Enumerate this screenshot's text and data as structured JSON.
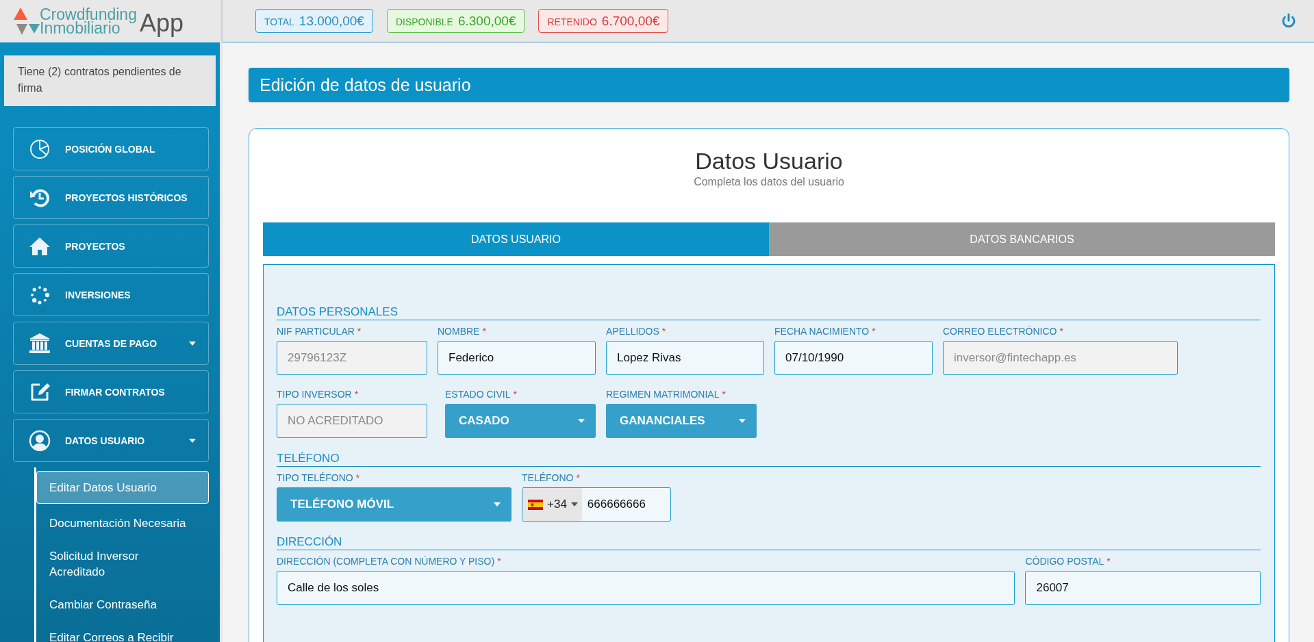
{
  "logo": {
    "line_1": "Crowdfunding",
    "line_2": "Inmobiliario",
    "app": "App"
  },
  "balances": [
    {
      "kind": "total",
      "label": "TOTAL",
      "amount": "13.000,00€"
    },
    {
      "kind": "available",
      "label": "DISPONIBLE",
      "amount": "6.300,00€"
    },
    {
      "kind": "held",
      "label": "RETENIDO",
      "amount": "6.700,00€"
    }
  ],
  "sidebar": {
    "notice": "Tiene (2) contratos pendientes de firma",
    "items": [
      {
        "label": "POSICIÓN GLOBAL",
        "expandable": false
      },
      {
        "label": "PROYECTOS HISTÓRICOS",
        "expandable": false
      },
      {
        "label": "PROYECTOS",
        "expandable": false
      },
      {
        "label": "INVERSIONES",
        "expandable": false
      },
      {
        "label": "CUENTAS DE PAGO",
        "expandable": true
      },
      {
        "label": "FIRMAR CONTRATOS",
        "expandable": false
      },
      {
        "label": "DATOS USUARIO",
        "expandable": true,
        "children": [
          {
            "label": "Editar Datos Usuario",
            "selected": true
          },
          {
            "label": "Documentación Necesaria",
            "selected": false
          },
          {
            "label": "Solicitud Inversor Acreditado",
            "selected": false
          },
          {
            "label": "Cambiar Contraseña",
            "selected": false
          },
          {
            "label": "Editar Correos a Recibir",
            "selected": false
          }
        ]
      }
    ]
  },
  "page_title": "Edición de datos de usuario",
  "card": {
    "title": "Datos Usuario",
    "subtitle": "Completa los datos del usuario",
    "tabs": [
      {
        "label": "DATOS USUARIO",
        "selected": true
      },
      {
        "label": "DATOS BANCARIOS",
        "selected": false
      }
    ],
    "sections": [
      {
        "title": "DATOS PERSONALES",
        "rows": [
          [
            {
              "kind": "input",
              "label": "NIF PARTICULAR",
              "mark": "*",
              "value": "29796123Z",
              "disabled": true
            },
            {
              "kind": "input",
              "label": "NOMBRE",
              "mark": "*",
              "value": "Federico",
              "disabled": false
            },
            {
              "kind": "input",
              "label": "APELLIDOS",
              "mark": "*",
              "value": "Lopez Rivas",
              "disabled": false
            },
            {
              "kind": "input",
              "label": "FECHA NACIMIENTO",
              "mark": "*",
              "value": "07/10/1990",
              "disabled": false
            },
            {
              "kind": "input",
              "label": "CORREO ELECTRÓNICO",
              "mark": "*",
              "value": "inversor@fintechapp.es",
              "disabled": true
            }
          ],
          [
            {
              "kind": "input",
              "label": "TIPO INVERSOR",
              "mark": "*",
              "value": "NO ACREDITADO",
              "disabled": true
            },
            {
              "kind": "select",
              "label": "ESTADO CIVIL",
              "mark": "*",
              "value": "CASADO"
            },
            {
              "kind": "select",
              "label": "REGIMEN MATRIMONIAL",
              "mark": "*",
              "value": "GANANCIALES"
            }
          ]
        ]
      },
      {
        "title": "TELÉFONO",
        "rows": [
          [
            {
              "kind": "select",
              "label": "TIPO TELÉFONO",
              "mark": "*",
              "value": "TELÉFONO MÓVIL"
            },
            {
              "kind": "phone",
              "label": "TELÉFONO",
              "mark": "*",
              "dial_code": "+34",
              "value": "666666666"
            }
          ]
        ]
      },
      {
        "title": "DIRECCIÓN",
        "rows": [
          [
            {
              "kind": "input",
              "label": "DIRECCIÓN (COMPLETA CON NÚMERO Y PISO)",
              "mark": "*",
              "value": "Calle de los soles",
              "disabled": false
            },
            {
              "kind": "input",
              "label": "CÓDIGO POSTAL",
              "mark": "*",
              "value": "26007",
              "disabled": false
            }
          ]
        ]
      }
    ]
  }
}
